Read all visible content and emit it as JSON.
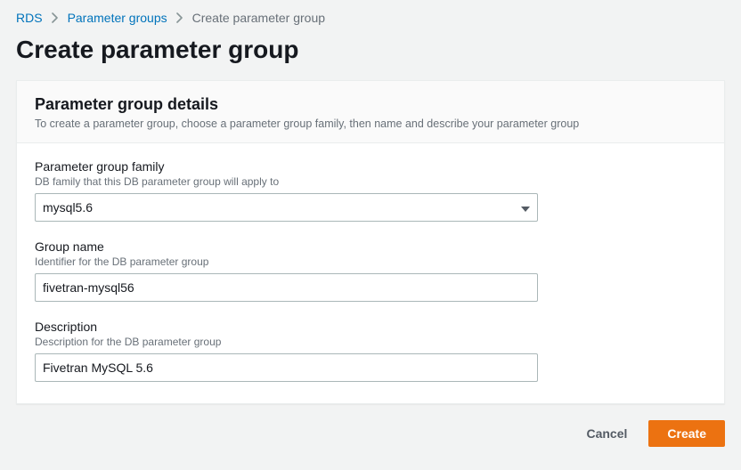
{
  "breadcrumb": {
    "root": "RDS",
    "parent": "Parameter groups",
    "current": "Create parameter group"
  },
  "page": {
    "title": "Create parameter group"
  },
  "details": {
    "heading": "Parameter group details",
    "subtitle": "To create a parameter group, choose a parameter group family, then name and describe your parameter group",
    "family": {
      "label": "Parameter group family",
      "help": "DB family that this DB parameter group will apply to",
      "value": "mysql5.6"
    },
    "name": {
      "label": "Group name",
      "help": "Identifier for the DB parameter group",
      "value": "fivetran-mysql56"
    },
    "description": {
      "label": "Description",
      "help": "Description for the DB parameter group",
      "value": "Fivetran MySQL 5.6"
    }
  },
  "actions": {
    "cancel": "Cancel",
    "create": "Create"
  }
}
